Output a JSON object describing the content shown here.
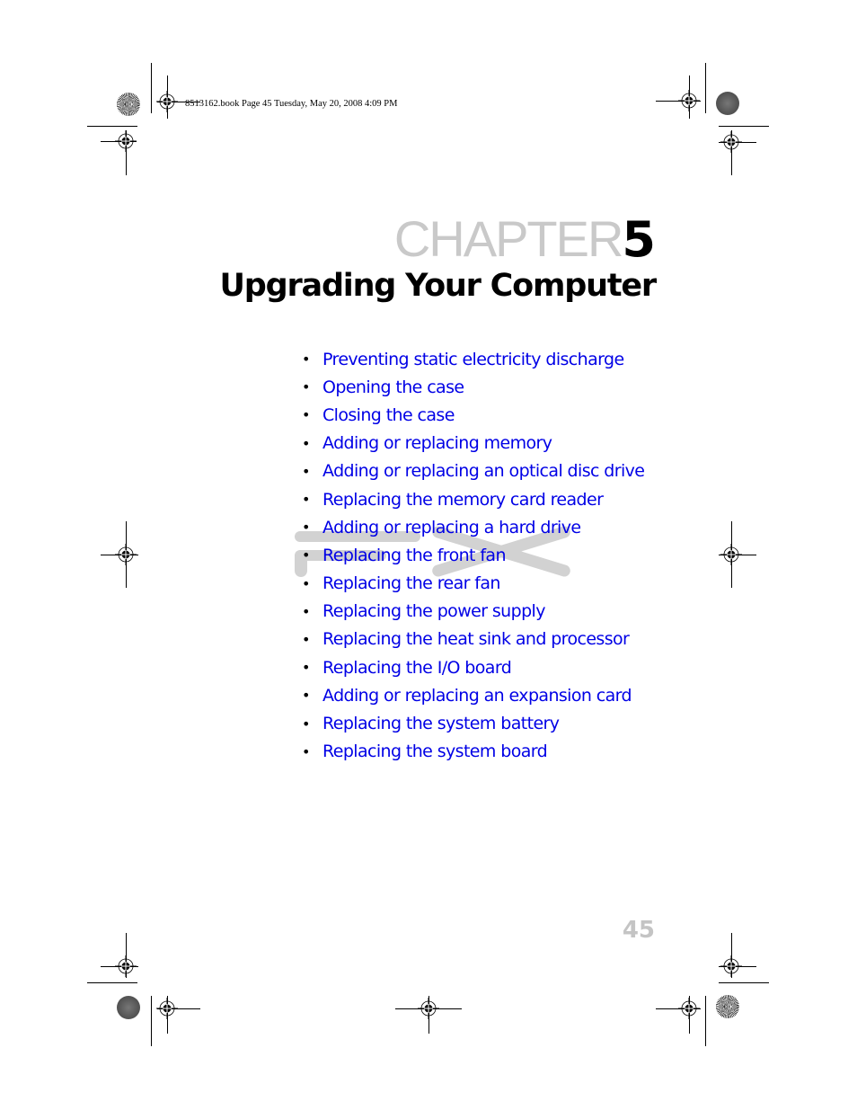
{
  "slug": "8513162.book  Page 45  Tuesday, May 20, 2008  4:09 PM",
  "chapter": {
    "word": "CHAPTER",
    "number": "5"
  },
  "title": "Upgrading Your Computer",
  "bullet_char": "•",
  "toc": [
    {
      "label": "Preventing static electricity discharge"
    },
    {
      "label": "Opening the case"
    },
    {
      "label": "Closing the case"
    },
    {
      "label": "Adding or replacing memory"
    },
    {
      "label": "Adding or replacing an optical disc drive"
    },
    {
      "label": "Replacing the memory card reader"
    },
    {
      "label": "Adding or replacing a hard drive"
    },
    {
      "label": "Replacing the front fan"
    },
    {
      "label": "Replacing the rear fan"
    },
    {
      "label": "Replacing the power supply"
    },
    {
      "label": "Replacing the heat sink and processor"
    },
    {
      "label": "Replacing the I/O board"
    },
    {
      "label": "Adding or replacing an expansion card"
    },
    {
      "label": "Replacing the system battery"
    },
    {
      "label": "Replacing the system board"
    }
  ],
  "page_number": "45",
  "colors": {
    "link": "#0000e6",
    "chapter_word": "#c9c9c9",
    "watermark": "#d2d2d2",
    "page_number": "#c4c4c4"
  }
}
